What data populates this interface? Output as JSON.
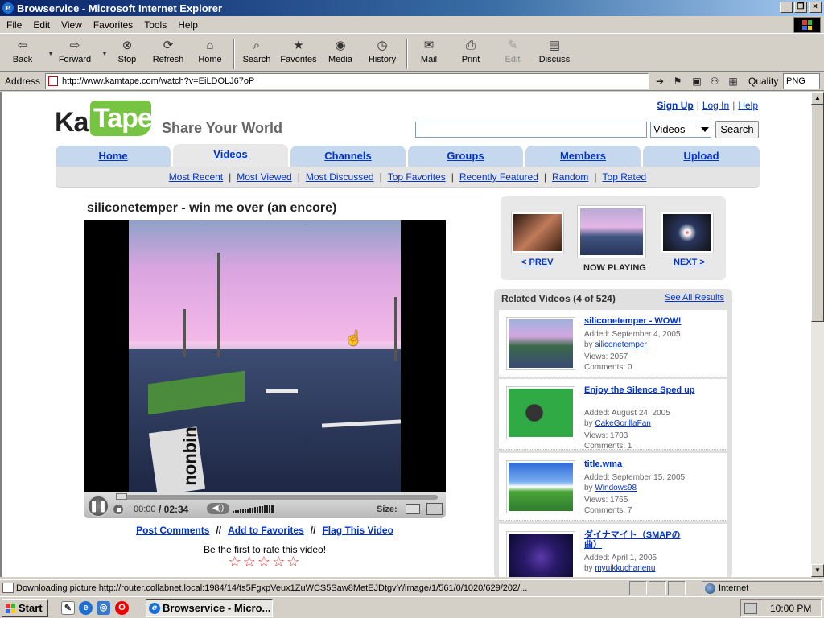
{
  "window": {
    "title": "Browservice - Microsoft Internet Explorer"
  },
  "menu": [
    "File",
    "Edit",
    "View",
    "Favorites",
    "Tools",
    "Help"
  ],
  "toolbar": {
    "back": "Back",
    "forward": "Forward",
    "stop": "Stop",
    "refresh": "Refresh",
    "home": "Home",
    "search": "Search",
    "favorites": "Favorites",
    "media": "Media",
    "history": "History",
    "mail": "Mail",
    "print": "Print",
    "edit": "Edit",
    "discuss": "Discuss"
  },
  "address": {
    "label": "Address",
    "url": "http://www.kamtape.com/watch?v=EiLDOLJ67oP",
    "quality_label": "Quality",
    "quality_value": "PNG"
  },
  "page": {
    "logo_kam": "Kam",
    "logo_tape": "Tape",
    "tagline": "Share Your World",
    "toplinks": {
      "signup": "Sign Up",
      "login": "Log In",
      "help": "Help"
    },
    "search": {
      "value": "",
      "category": "Videos",
      "button": "Search"
    },
    "tabs": [
      "Home",
      "Videos",
      "Channels",
      "Groups",
      "Members",
      "Upload"
    ],
    "active_tab": "Videos",
    "subnav": [
      "Most Recent",
      "Most Viewed",
      "Most Discussed",
      "Top Favorites",
      "Recently Featured",
      "Random",
      "Top Rated"
    ],
    "video": {
      "title": "siliconetemper - win me over (an encore)",
      "time_current": "00:00",
      "time_total": "/ 02:34",
      "size_label": "Size:",
      "progress_fraction": 0
    },
    "actions": {
      "comments": "Post Comments",
      "favorites": "Add to Favorites",
      "flag": "Flag This Video",
      "sep": "//"
    },
    "rating": {
      "prompt": "Be the first to rate this video!",
      "stars": "☆☆☆☆☆",
      "rating_value": 0
    },
    "navstrip": {
      "prev": "< PREV",
      "now": "NOW PLAYING",
      "next": "NEXT >"
    },
    "related": {
      "header": "Related Videos (4 of 524)",
      "see_all": "See All Results",
      "items": [
        {
          "title": "siliconetemper - WOW!",
          "added": "Added: September 4, 2005",
          "by_prefix": "by ",
          "by": "siliconetemper",
          "views": "Views: 2057",
          "comments": "Comments: 0"
        },
        {
          "title": "Enjoy the Silence Sped up",
          "added": "Added: August 24, 2005",
          "by_prefix": "by ",
          "by": "CakeGorillaFan",
          "views": "Views: 1703",
          "comments": "Comments: 1"
        },
        {
          "title": "title.wma",
          "added": "Added: September 15, 2005",
          "by_prefix": "by ",
          "by": "Windows98",
          "views": "Views: 1765",
          "comments": "Comments: 7"
        },
        {
          "title": "ダイナマイト（SMAPの曲）",
          "added": "Added: April 1, 2005",
          "by_prefix": "by ",
          "by": "myuikkuchanenu",
          "views": "",
          "comments": ""
        }
      ]
    }
  },
  "status": {
    "text": "Downloading picture http://router.collabnet.local:1984/14/ts5FgxpVeux1ZuWCS5Saw8MetEJDtgvY/image/1/561/0/1020/629/202/...",
    "zone": "Internet"
  },
  "taskbar": {
    "start": "Start",
    "task": "Browservice - Micro...",
    "clock": "10:00 PM"
  },
  "colors": {
    "titlebar": "#0a246a",
    "link": "#0033cc",
    "tab": "#c6d8ee",
    "logo_green": "#76c442"
  }
}
